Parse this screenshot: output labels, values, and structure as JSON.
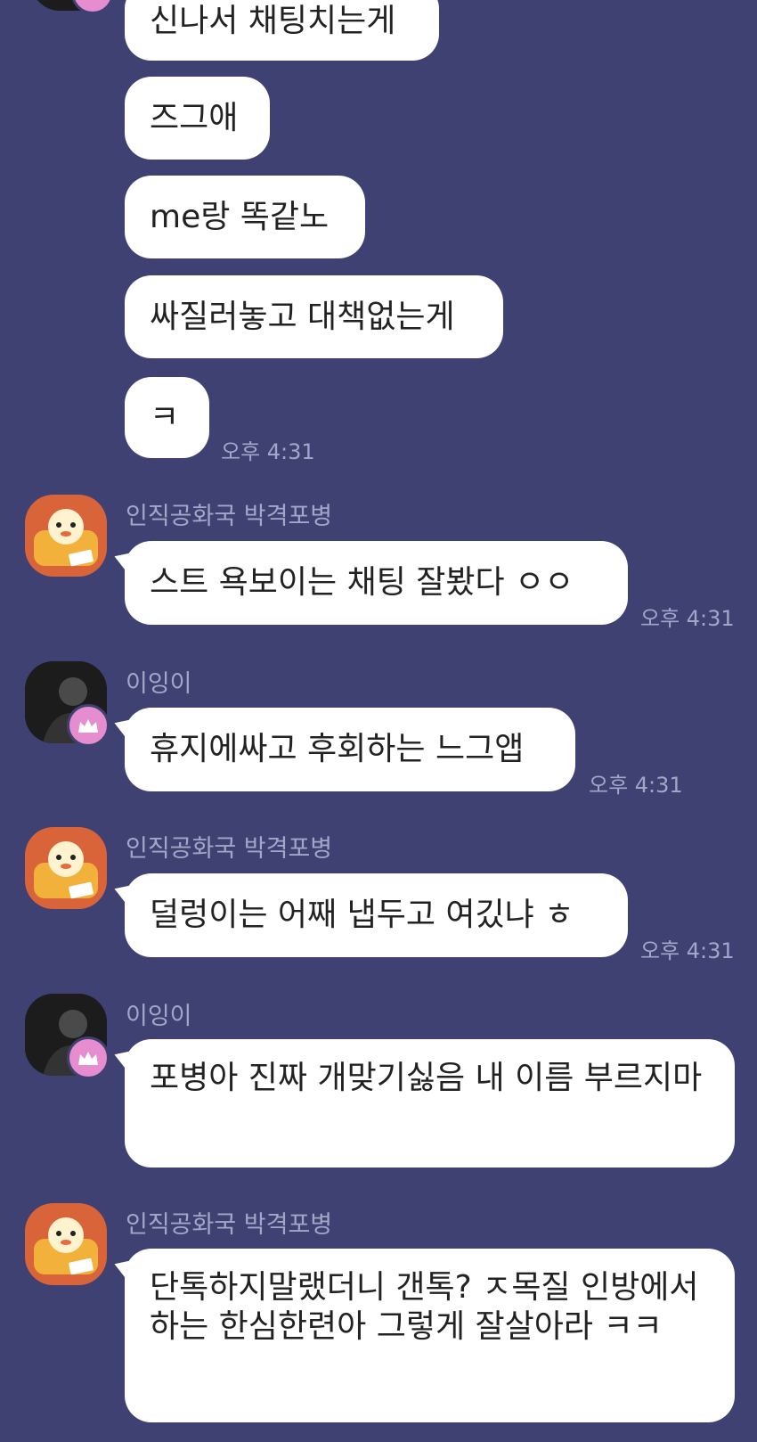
{
  "chat": {
    "colors": {
      "background": "#3f4173",
      "bubble": "#ffffff",
      "meta_text": "#a3a6c8",
      "crown_badge": "#e68dcf",
      "avatar_orange": "#d9643a"
    },
    "messages": [
      {
        "sender": "",
        "text": "신나서 채팅치는게",
        "time": ""
      },
      {
        "sender": "",
        "text": "즈그애",
        "time": ""
      },
      {
        "sender": "",
        "text": "me랑 똑같노",
        "time": ""
      },
      {
        "sender": "",
        "text": "싸질러놓고 대책없는게",
        "time": ""
      },
      {
        "sender": "",
        "text": "ㅋ",
        "time": "오후 4:31"
      },
      {
        "sender": "인직공화국 박격포병",
        "text": "스트 욕보이는 채팅 잘봤다 ㅇㅇ",
        "time": "오후 4:31"
      },
      {
        "sender": "이잉이",
        "text": "휴지에싸고 후회하는 느그앱",
        "time": "오후 4:31"
      },
      {
        "sender": "인직공화국 박격포병",
        "text": "덜렁이는 어째 냅두고 여깄냐 ㅎ",
        "time": "오후 4:31"
      },
      {
        "sender": "이잉이",
        "text": "포병아 진짜 개맞기싫음 내 이름 부르지마",
        "time": ""
      },
      {
        "sender": "인직공화국 박격포병",
        "text": "단톡하지말랬더니 갠톡? ㅈ목질 인방에서 하는 한심한련아 그렇게 잘살아라 ㅋㅋ",
        "time": ""
      }
    ]
  }
}
